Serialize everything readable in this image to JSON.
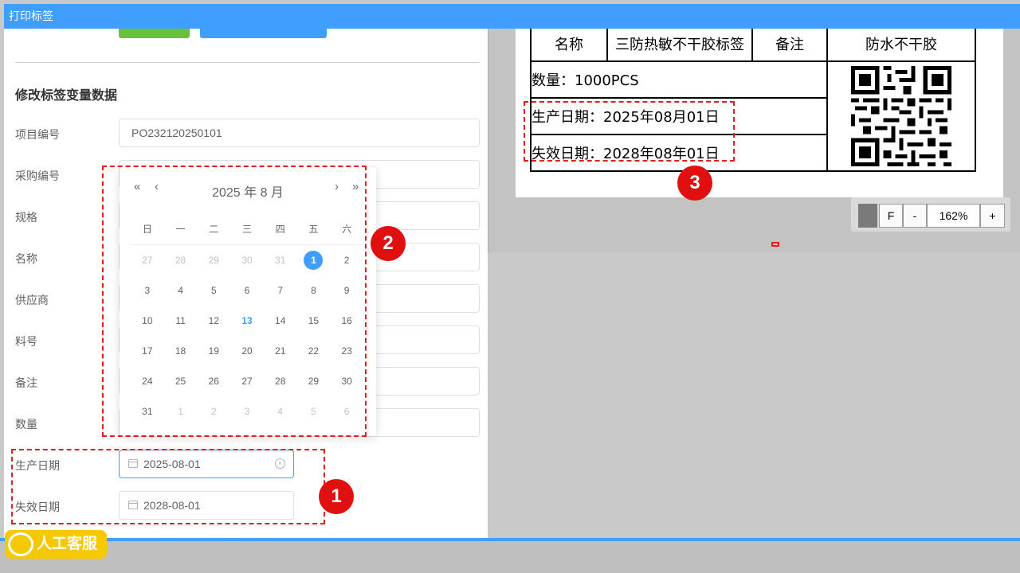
{
  "window": {
    "title": "打印标签"
  },
  "form": {
    "section_title": "修改标签变量数据",
    "fields": [
      {
        "label": "项目编号",
        "value": "PO232120250101"
      },
      {
        "label": "采购编号",
        "value": ""
      },
      {
        "label": "规格",
        "value": ""
      },
      {
        "label": "名称",
        "value": ""
      },
      {
        "label": "供应商",
        "value": ""
      },
      {
        "label": "料号",
        "value": ""
      },
      {
        "label": "备注",
        "value": ""
      },
      {
        "label": "数量",
        "value": ""
      }
    ],
    "production_date": {
      "label": "生产日期",
      "value": "2025-08-01"
    },
    "expiry_date": {
      "label": "失效日期",
      "value": "2028-08-01"
    }
  },
  "calendar": {
    "title": "2025 年  8 月",
    "prev_year": "«",
    "prev_month": "‹",
    "next_month": "›",
    "next_year": "»",
    "weekdays": [
      "日",
      "一",
      "二",
      "三",
      "四",
      "五",
      "六"
    ],
    "days": [
      {
        "d": "27",
        "other": true
      },
      {
        "d": "28",
        "other": true
      },
      {
        "d": "29",
        "other": true
      },
      {
        "d": "30",
        "other": true
      },
      {
        "d": "31",
        "other": true
      },
      {
        "d": "1",
        "selected": true
      },
      {
        "d": "2"
      },
      {
        "d": "3"
      },
      {
        "d": "4"
      },
      {
        "d": "5"
      },
      {
        "d": "6"
      },
      {
        "d": "7"
      },
      {
        "d": "8"
      },
      {
        "d": "9"
      },
      {
        "d": "10"
      },
      {
        "d": "11"
      },
      {
        "d": "12"
      },
      {
        "d": "13",
        "today": true
      },
      {
        "d": "14"
      },
      {
        "d": "15"
      },
      {
        "d": "16"
      },
      {
        "d": "17"
      },
      {
        "d": "18"
      },
      {
        "d": "19"
      },
      {
        "d": "20"
      },
      {
        "d": "21"
      },
      {
        "d": "22"
      },
      {
        "d": "23"
      },
      {
        "d": "24"
      },
      {
        "d": "25"
      },
      {
        "d": "26"
      },
      {
        "d": "27"
      },
      {
        "d": "28"
      },
      {
        "d": "29"
      },
      {
        "d": "30"
      },
      {
        "d": "31"
      },
      {
        "d": "1",
        "other": true
      },
      {
        "d": "2",
        "other": true
      },
      {
        "d": "3",
        "other": true
      },
      {
        "d": "4",
        "other": true
      },
      {
        "d": "5",
        "other": true
      },
      {
        "d": "6",
        "other": true
      }
    ]
  },
  "preview": {
    "name_label": "名称",
    "name_value": "三防热敏不干胶标签",
    "remark_label": "备注",
    "remark_value": "防水不干胶",
    "qty_text": "数量：1000PCS",
    "prod_text": "生产日期：2025年08月01日",
    "exp_text": "失效日期：2028年08年01日",
    "zoom": {
      "f_label": "F",
      "minus_label": "-",
      "level": "162%",
      "plus_label": "+"
    }
  },
  "annotations": {
    "m1": "1",
    "m2": "2",
    "m3": "3"
  },
  "support": {
    "label": "人工客服"
  },
  "colors": {
    "primary": "#409eff",
    "success": "#67c23a",
    "annotation": "#e01010",
    "support": "#f5c800"
  }
}
